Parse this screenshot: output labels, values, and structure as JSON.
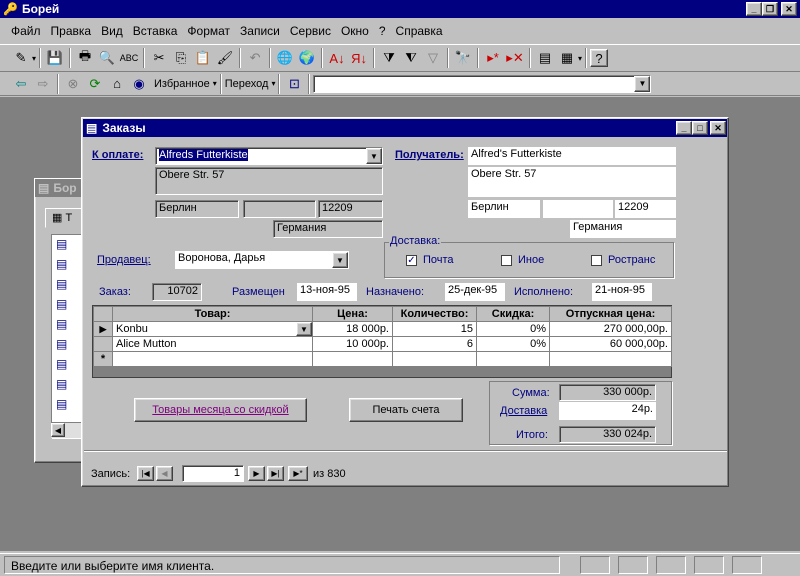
{
  "app": {
    "title": "Борей"
  },
  "menu": [
    "Файл",
    "Правка",
    "Вид",
    "Вставка",
    "Формат",
    "Записи",
    "Сервис",
    "Окно",
    "?",
    "Справка"
  ],
  "webbar": {
    "favorites": "Избранное",
    "goto": "Переход"
  },
  "bg_window": {
    "title": "Бор",
    "tab": "Т"
  },
  "form": {
    "title": "Заказы",
    "bill_label": "К оплате:",
    "bill_name": "Alfreds Futterkiste",
    "bill_address": "Obere Str. 57",
    "bill_city": "Берлин",
    "bill_region": "",
    "bill_zip": "12209",
    "bill_country": "Германия",
    "ship_label": "Получатель:",
    "ship_name": "Alfred's Futterkiste",
    "ship_address": "Obere Str. 57",
    "ship_city": "Берлин",
    "ship_region": "",
    "ship_zip": "12209",
    "ship_country": "Германия",
    "seller_label": "Продавец:",
    "seller": "Воронова, Дарья",
    "delivery_label": "Доставка:",
    "delivery_options": [
      {
        "label": "Почта",
        "checked": true
      },
      {
        "label": "Иное",
        "checked": false
      },
      {
        "label": "Ространс",
        "checked": false
      }
    ],
    "order_label": "Заказ:",
    "order_no": "10702",
    "placed_label": "Размещен",
    "placed": "13-ноя-95",
    "assigned_label": "Назначено:",
    "assigned": "25-дек-95",
    "done_label": "Исполнено:",
    "done": "21-ноя-95",
    "grid_headers": [
      "Товар:",
      "Цена:",
      "Количество:",
      "Скидка:",
      "Отпускная цена:"
    ],
    "rows": [
      {
        "product": "Konbu",
        "price": "18 000р.",
        "qty": "15",
        "discount": "0%",
        "total": "270 000,00р."
      },
      {
        "product": "Alice Mutton",
        "price": "10 000р.",
        "qty": "6",
        "discount": "0%",
        "total": "60 000,00р."
      }
    ],
    "new_row_marker": "*",
    "btn_discount": "Товары месяца со скидкой",
    "btn_print": "Печать счета",
    "sum_label": "Сумма:",
    "sum": "330 000р.",
    "shipping_label": "Доставка",
    "shipping": "24р.",
    "total_label": "Итого:",
    "total": "330 024р.",
    "record_label": "Запись:",
    "record_no": "1",
    "record_of": "из  830"
  },
  "status": {
    "text": "Введите или выберите имя клиента."
  }
}
